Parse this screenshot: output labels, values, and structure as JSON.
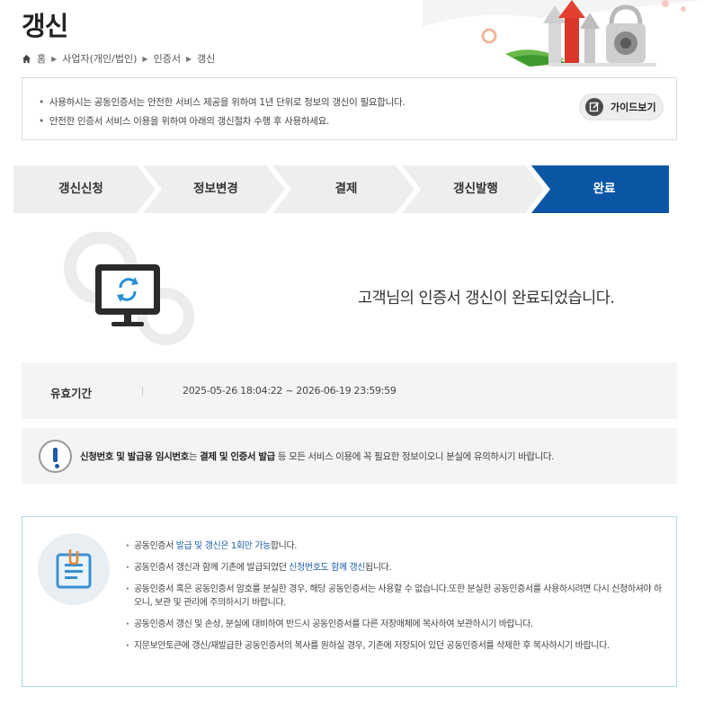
{
  "page": {
    "title": "갱신"
  },
  "breadcrumb": {
    "home": "홈",
    "items": [
      "사업자(개인/법인)",
      "인증서",
      "갱신"
    ]
  },
  "notice": {
    "items": [
      "사용하시는 공동인증서는 안전한 서비스 제공을 위하여 1년 단위로 정보의 갱신이 필요합니다.",
      "안전한 인증서 서비스 이용을 위하여 아래의 갱신절차 수행 후 사용하세요."
    ],
    "guide_button": "가이드보기"
  },
  "steps": {
    "items": [
      "갱신신청",
      "정보변경",
      "결제",
      "갱신발행",
      "완료"
    ],
    "active_index": 4,
    "active_color": "#0b56a4",
    "inactive_color": "#eeeeee"
  },
  "complete": {
    "message": "고객님의 인증서 갱신이 완료되었습니다."
  },
  "validity": {
    "label": "유효기간",
    "value": "2025-05-26 18:04:22 ~ 2026-06-19 23:59:59"
  },
  "warning": {
    "part1": "신청번호 및 발급용 임시번호",
    "part2": "는 ",
    "part3": "결제 및 인증서 발급",
    "part4": " 등 모든 서비스 이용에 꼭 필요한 정보이오니 분실에 유의하시기 바랍니다."
  },
  "info": {
    "item1": {
      "a": "공동인증서 ",
      "b": "발급 및 갱신은 1회만 가능",
      "c": "합니다."
    },
    "item2": {
      "a": "공동인증서 갱신과 함께 기존에 발급되었던 ",
      "b": "신청번호도 함께 갱신",
      "c": "됩니다."
    },
    "item3": "공동인증서 혹은 공동인증서 암호를 분실한 경우, 해당 공동인증서는 사용할 수 없습니다.또한 분실한 공동인증서를 사용하시려면 다시 신청하셔야 하오니, 보관 및 관리에 주의하시기 바랍니다.",
    "item4": "공동인증서 갱신 및 손상, 분실에 대비하여 반드시 공동인증서를 다른 저장매체에 복사하여 보관하시기 바랍니다.",
    "item5": "지문보안토큰에 갱신/재발급한 공동인증서의 복사를 원하실 경우, 기존에 저장되어 있던 공동인증서를 삭제한 후 복사하시기 바랍니다."
  },
  "colors": {
    "accent": "#0b56a4",
    "highlight_text": "#1f5fa8",
    "info_border": "#a9dbe8"
  },
  "icons": {
    "home": "home-icon",
    "guide": "document-edit-icon",
    "monitor": "monitor-refresh-icon",
    "warning": "exclamation-icon",
    "clipboard": "clipboard-icon",
    "hero": "certificate-lock-illustration"
  }
}
